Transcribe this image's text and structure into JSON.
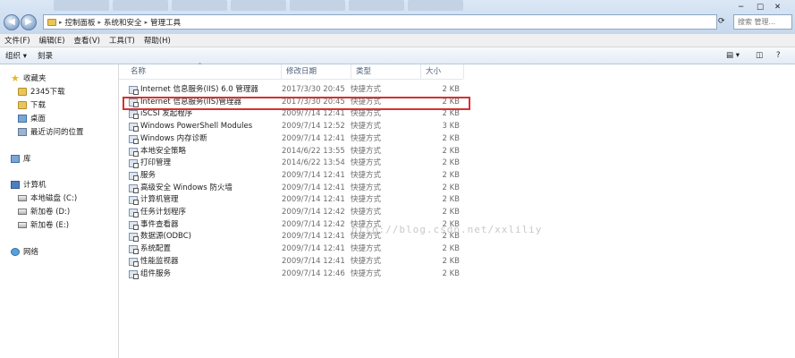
{
  "address": {
    "crumbs": [
      "控制面板",
      "系统和安全",
      "管理工具"
    ]
  },
  "search": {
    "placeholder": "搜索 管理..."
  },
  "menu": [
    "文件(F)",
    "编辑(E)",
    "查看(V)",
    "工具(T)",
    "帮助(H)"
  ],
  "toolbar": {
    "organize": "组织 ▾",
    "burn": "刻录"
  },
  "sidebar": {
    "favorites": "收藏夹",
    "favorites_items": [
      "2345下载",
      "下载",
      "桌面",
      "最近访问的位置"
    ],
    "libraries": "库",
    "computer": "计算机",
    "computer_items": [
      "本地磁盘 (C:)",
      "新加卷 (D:)",
      "新加卷 (E:)"
    ],
    "network": "网络"
  },
  "columns": {
    "name": "名称",
    "date": "修改日期",
    "type": "类型",
    "size": "大小"
  },
  "files": [
    {
      "name": "Internet 信息服务(IIS) 6.0 管理器",
      "date": "2017/3/30 20:45",
      "type": "快捷方式",
      "size": "2 KB"
    },
    {
      "name": "Internet 信息服务(IIS)管理器",
      "date": "2017/3/30 20:45",
      "type": "快捷方式",
      "size": "2 KB"
    },
    {
      "name": "iSCSI 发起程序",
      "date": "2009/7/14 12:41",
      "type": "快捷方式",
      "size": "2 KB"
    },
    {
      "name": "Windows PowerShell Modules",
      "date": "2009/7/14 12:52",
      "type": "快捷方式",
      "size": "3 KB"
    },
    {
      "name": "Windows 内存诊断",
      "date": "2009/7/14 12:41",
      "type": "快捷方式",
      "size": "2 KB"
    },
    {
      "name": "本地安全策略",
      "date": "2014/6/22 13:55",
      "type": "快捷方式",
      "size": "2 KB"
    },
    {
      "name": "打印管理",
      "date": "2014/6/22 13:54",
      "type": "快捷方式",
      "size": "2 KB"
    },
    {
      "name": "服务",
      "date": "2009/7/14 12:41",
      "type": "快捷方式",
      "size": "2 KB"
    },
    {
      "name": "高级安全 Windows 防火墙",
      "date": "2009/7/14 12:41",
      "type": "快捷方式",
      "size": "2 KB"
    },
    {
      "name": "计算机管理",
      "date": "2009/7/14 12:41",
      "type": "快捷方式",
      "size": "2 KB"
    },
    {
      "name": "任务计划程序",
      "date": "2009/7/14 12:42",
      "type": "快捷方式",
      "size": "2 KB"
    },
    {
      "name": "事件查看器",
      "date": "2009/7/14 12:42",
      "type": "快捷方式",
      "size": "2 KB"
    },
    {
      "name": "数据源(ODBC)",
      "date": "2009/7/14 12:41",
      "type": "快捷方式",
      "size": "2 KB"
    },
    {
      "name": "系统配置",
      "date": "2009/7/14 12:41",
      "type": "快捷方式",
      "size": "2 KB"
    },
    {
      "name": "性能监视器",
      "date": "2009/7/14 12:41",
      "type": "快捷方式",
      "size": "2 KB"
    },
    {
      "name": "组件服务",
      "date": "2009/7/14 12:46",
      "type": "快捷方式",
      "size": "2 KB"
    }
  ],
  "watermark": "http://blog.csdn.net/xxliliy",
  "colors": {
    "highlight": "#d6322f",
    "chrome": "#c6d8ee"
  }
}
